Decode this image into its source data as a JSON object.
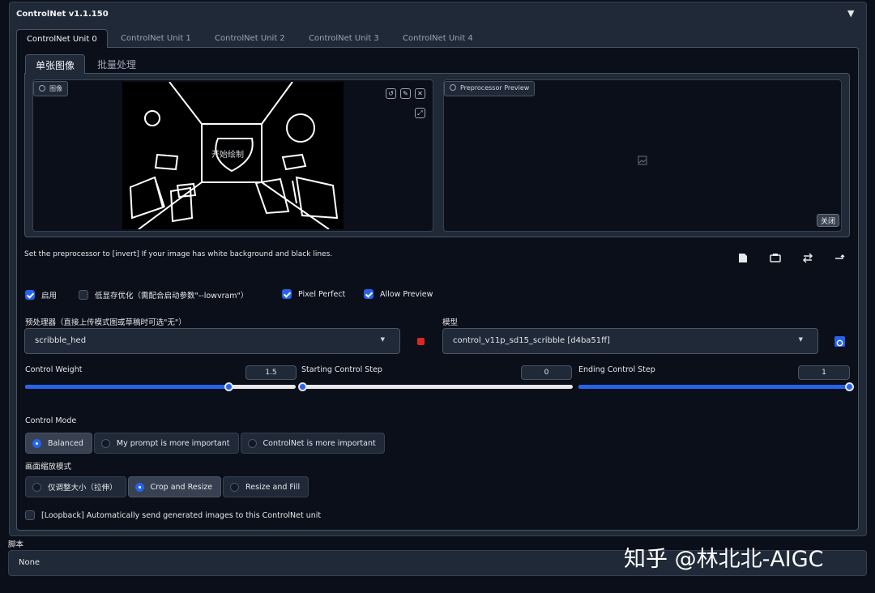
{
  "panel": {
    "title": "ControlNet v1.1.150",
    "collapse_icon": "▼"
  },
  "unit_tabs": [
    "ControlNet Unit 0",
    "ControlNet Unit 1",
    "ControlNet Unit 2",
    "ControlNet Unit 3",
    "ControlNet Unit 4"
  ],
  "inner_tabs": [
    "单张图像",
    "批量处理"
  ],
  "image_box": {
    "label": "图像",
    "label_icon": "image-icon",
    "canvas_text": "开始绘制",
    "tools": [
      "↺",
      "✎",
      "✕"
    ],
    "extra_tool": "⤢"
  },
  "preview_box": {
    "label": "Preprocessor Preview",
    "close_label": "关闭",
    "placeholder_icon": "broken-image-icon"
  },
  "hint": "Set the preprocessor to [invert] If your image has white background and black lines.",
  "action_icons": [
    "new-canvas-icon",
    "camera-icon",
    "swap-icon",
    "send-dimensions-icon"
  ],
  "checkboxes": [
    {
      "label": "启用",
      "checked": true
    },
    {
      "label": "低显存优化（需配合启动参数\"--lowvram\"）",
      "checked": false
    },
    {
      "label": "Pixel Perfect",
      "checked": true
    },
    {
      "label": "Allow Preview",
      "checked": true
    }
  ],
  "preprocessor": {
    "label": "预处理器（直接上传模式图或草稿时可选\"无\"）",
    "value": "scribble_hed"
  },
  "model": {
    "label": "模型",
    "value": "control_v11p_sd15_scribble [d4ba51ff]"
  },
  "sliders": {
    "weight": {
      "label": "Control Weight",
      "value": "1.5",
      "fraction": 0.75
    },
    "start": {
      "label": "Starting Control Step",
      "value": "0",
      "fraction": 0.0
    },
    "end": {
      "label": "Ending Control Step",
      "value": "1",
      "fraction": 1.0
    }
  },
  "control_mode": {
    "label": "Control Mode",
    "options": [
      "Balanced",
      "My prompt is more important",
      "ControlNet is more important"
    ],
    "selected": 0
  },
  "resize_mode": {
    "label": "画面缩放模式",
    "options": [
      "仅调整大小（拉伸）",
      "Crop and Resize",
      "Resize and Fill"
    ],
    "selected": 1
  },
  "loopback": {
    "label": "[Loopback] Automatically send generated images to this ControlNet unit",
    "checked": false
  },
  "script": {
    "label": "脚本",
    "value": "None"
  },
  "watermark": "知乎 @林北北-AIGC",
  "colors": {
    "accent": "#2563eb",
    "background": "#0b0f19",
    "panel": "#1f2937",
    "close_red": "#dc2626"
  }
}
